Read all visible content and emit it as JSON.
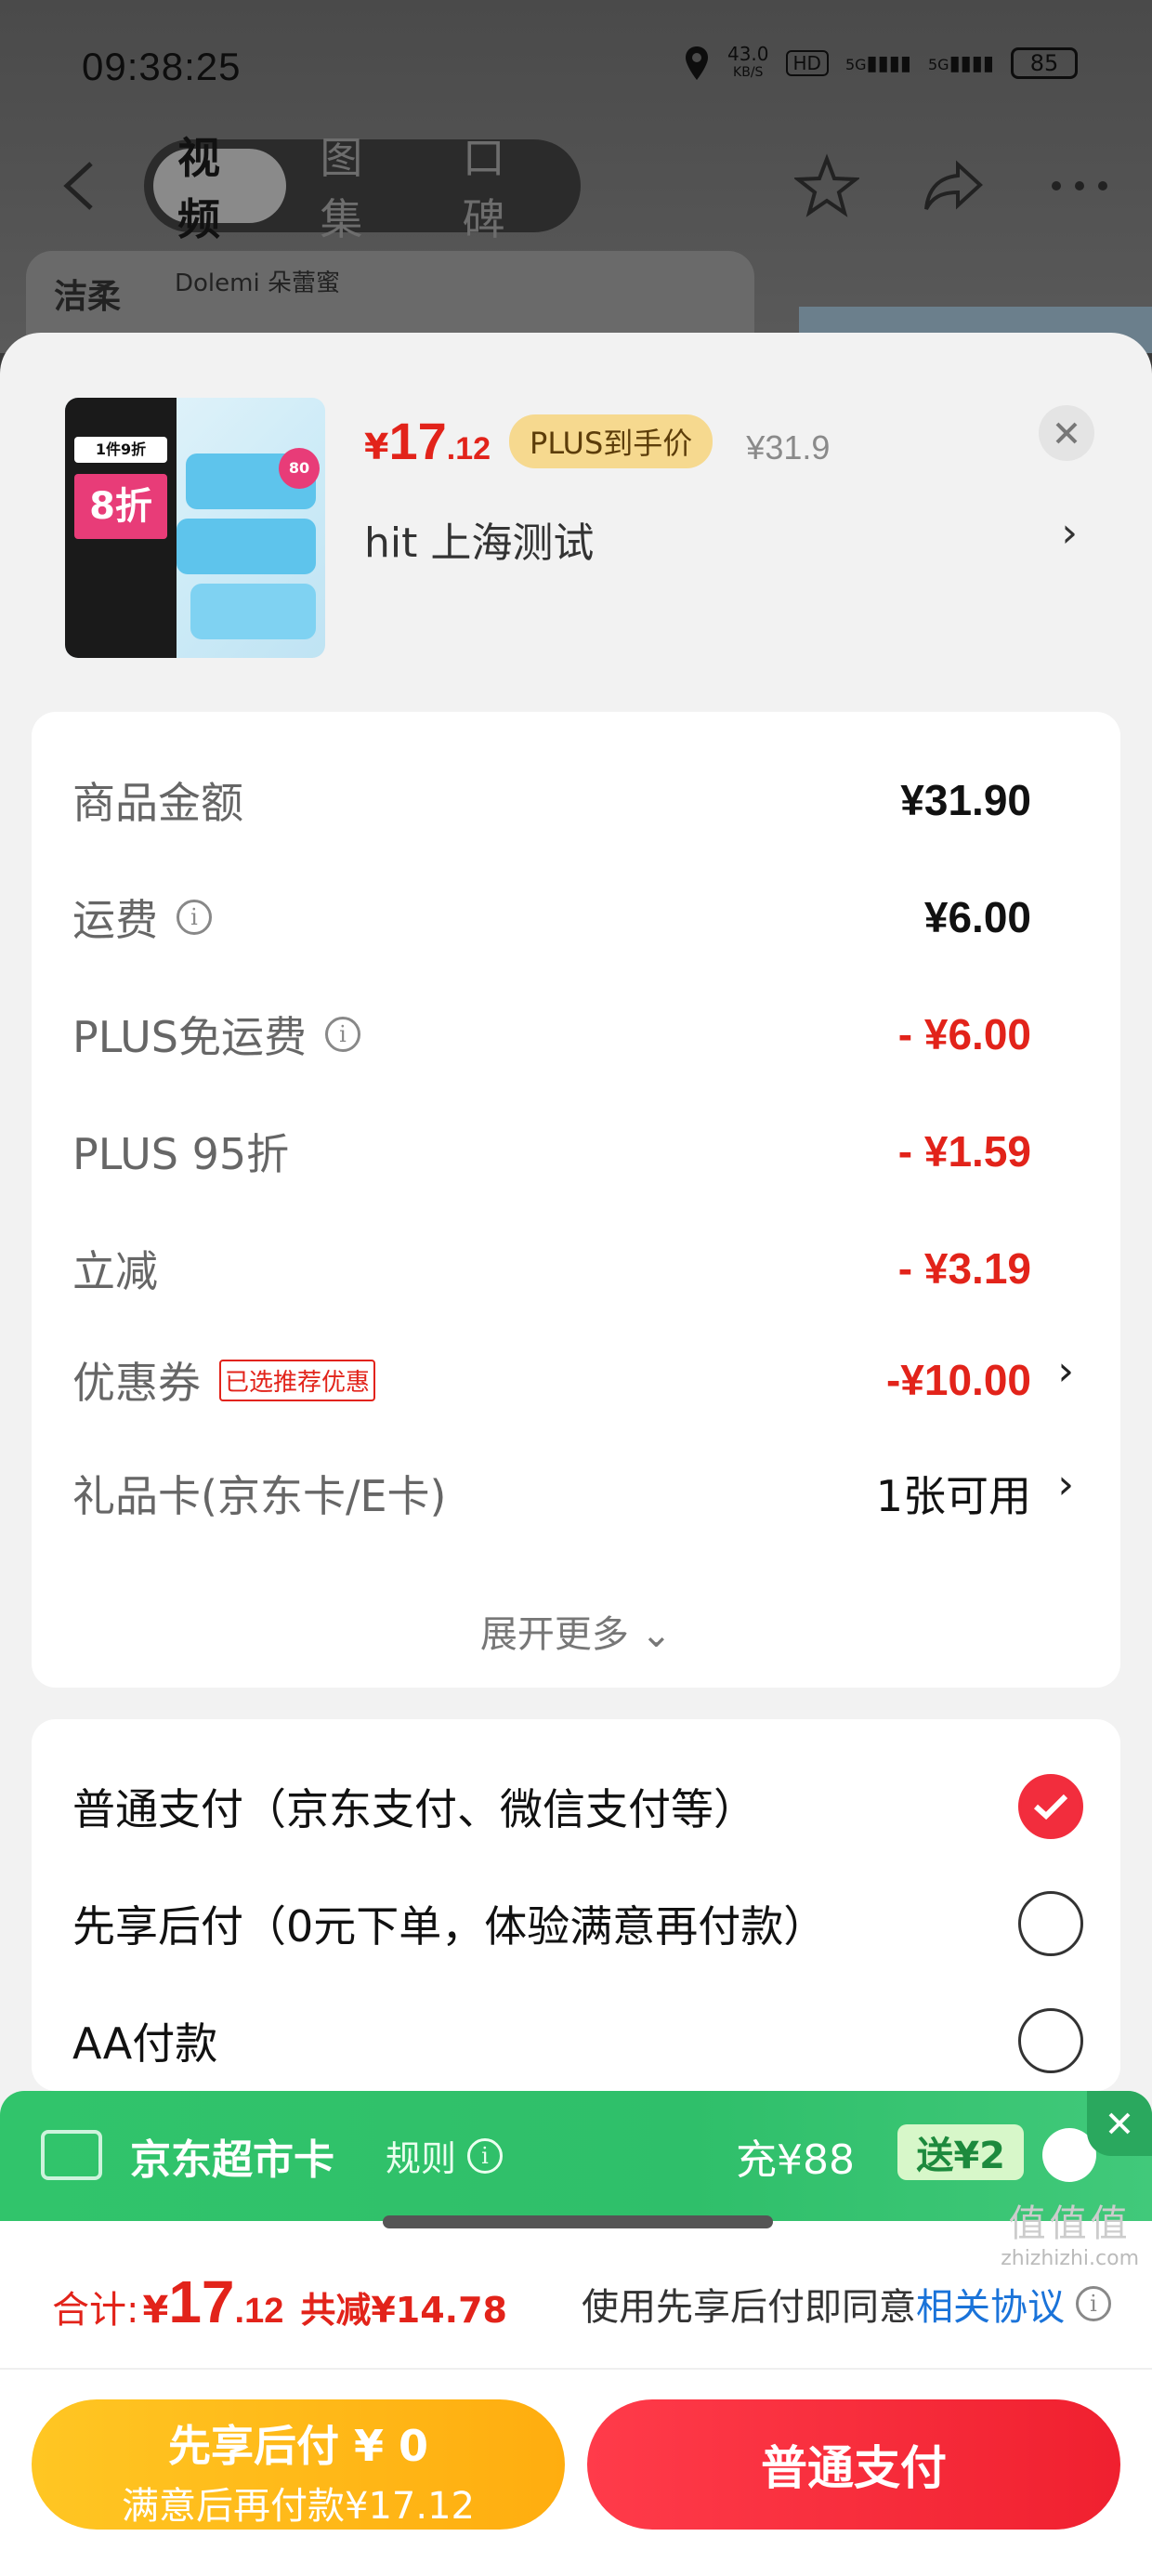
{
  "status_bar": {
    "time": "09:38:25",
    "speed_value": "43.0",
    "speed_unit": "KB/S",
    "hd_label": "HD",
    "net1": "5G",
    "net2": "5G",
    "battery": "85"
  },
  "nav": {
    "tabs": [
      {
        "label": "视频",
        "active": true
      },
      {
        "label": "图集",
        "active": false
      },
      {
        "label": "口碑",
        "active": false
      }
    ]
  },
  "background": {
    "brand_cn": "洁柔",
    "brand_en": "Dolemi 朵蕾蜜"
  },
  "product": {
    "thumb_badge_top": "1件9折",
    "thumb_badge_main": "8折",
    "thumb_circle": "80",
    "price_currency": "¥",
    "price_int": "17",
    "price_dec": ".12",
    "plus_tag": "PLUS到手价",
    "original_price": "¥31.9",
    "address": "hit  上海测试",
    "address_arrow": "›"
  },
  "fees": {
    "rows": [
      {
        "label": "商品金额",
        "value": "¥31.90"
      },
      {
        "label": "运费",
        "value": "¥6.00"
      },
      {
        "label": "PLUS免运费",
        "value": "- ¥6.00"
      },
      {
        "label": "PLUS 95折",
        "value": "- ¥1.59"
      },
      {
        "label": "立减",
        "value": "- ¥3.19"
      },
      {
        "label": "优惠券",
        "value": "-¥10.00",
        "tag": "已选推荐优惠"
      },
      {
        "label": "礼品卡(京东卡/E卡)",
        "value": "1张可用"
      }
    ],
    "expand_label": "展开更多 ⌄"
  },
  "payment": {
    "options": [
      {
        "label": "普通支付（京东支付、微信支付等）",
        "checked": true
      },
      {
        "label": "先享后付（0元下单，体验满意再付款）",
        "checked": false
      },
      {
        "label": "AA付款",
        "checked": false
      }
    ]
  },
  "promo": {
    "title": "京东超市卡",
    "rule": "规则",
    "charge": "充¥88",
    "gift": "送¥2"
  },
  "total": {
    "label": "合计:",
    "currency": "¥",
    "int": "17",
    "dec": ".12",
    "saved": "共减¥14.78",
    "agree_prefix": "使用先享后付即同意",
    "agree_link": "相关协议"
  },
  "actions": {
    "later_line1": "先享后付 ¥ 0",
    "later_line2": "满意后再付款¥17.12",
    "pay": "普通支付"
  },
  "watermark": {
    "main": "值值值",
    "sub": "zhizhizhi.com"
  },
  "colors": {
    "price_red": "#e2231a",
    "plus_gold": "#f6d98f",
    "promo_green": "#31c46b",
    "later_yellow": "#ffb81a",
    "pay_red": "#f22d3d",
    "link_blue": "#1a73d9"
  }
}
